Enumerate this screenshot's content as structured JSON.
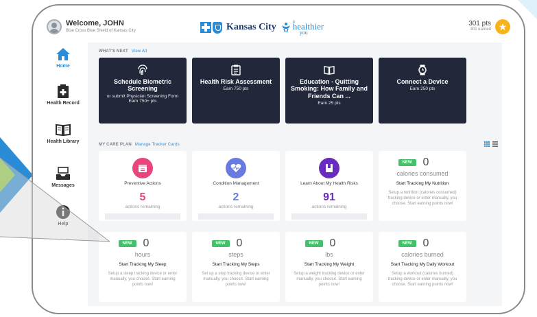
{
  "header": {
    "welcome": "Welcome, JOHN",
    "subtitle": "Blue Cross Blue Shield of Kansas City",
    "brand_city": "Kansas City",
    "brand_a": "a",
    "brand_healthier": "healthier",
    "brand_you": "you",
    "points": "301 pts",
    "points_earned": "301 earned"
  },
  "sidebar": {
    "items": [
      {
        "label": "Home",
        "icon": "home-icon",
        "active": true
      },
      {
        "label": "Health Record",
        "icon": "medical-record-icon"
      },
      {
        "label": "Health Library",
        "icon": "book-icon"
      },
      {
        "label": "Messages",
        "icon": "inbox-icon"
      },
      {
        "label": "Help",
        "icon": "info-icon"
      }
    ]
  },
  "whats_next": {
    "title": "WHAT'S NEXT",
    "link": "View All",
    "cards": [
      {
        "title": "Schedule Biometric Screening",
        "sub": "or submit Physician Screening Form",
        "pts": "Earn 750+ pts",
        "icon": "fingerprint-icon"
      },
      {
        "title": "Health Risk Assessment",
        "pts": "Earn 750 pts",
        "icon": "clipboard-icon"
      },
      {
        "title": "Education - Quitting Smoking: How Family and Friends Can ...",
        "pts": "Earn 25 pts",
        "icon": "open-book-icon"
      },
      {
        "title": "Connect a Device",
        "pts": "Earn 250 pts",
        "icon": "watch-icon"
      }
    ]
  },
  "care_plan": {
    "title": "MY CARE PLAN",
    "link": "Manage Tracker Cards",
    "cards": [
      {
        "name": "Preventive Actions",
        "value": "5",
        "sub": "actions remaining",
        "color": "#e8457e"
      },
      {
        "name": "Condition Management",
        "value": "2",
        "sub": "actions remaining",
        "color": "#6a7be0"
      },
      {
        "name": "Learn About My Health Risks",
        "value": "91",
        "sub": "actions remaining",
        "color": "#6a2bbf"
      }
    ],
    "trackers": [
      {
        "badge": "NEW",
        "value": "0",
        "unit": "calories consumed",
        "title": "Start Tracking My Nutrition",
        "desc": "Setup a nutrition (calories consumed) tracking device or enter manually, you choose. Start earning points now!"
      },
      {
        "badge": "NEW",
        "value": "0",
        "unit": "hours",
        "title": "Start Tracking My Sleep",
        "desc": "Setup a sleep tracking device or enter manually, you choose. Start earning points now!"
      },
      {
        "badge": "NEW",
        "value": "0",
        "unit": "steps",
        "title": "Start Tracking My Steps",
        "desc": "Set up a step tracking device or enter manually, you choose. Start earning points now!"
      },
      {
        "badge": "NEW",
        "value": "0",
        "unit": "lbs",
        "title": "Start Tracking My Weight",
        "desc": "Setup a weight tracking device or enter manually, you choose. Start earning points now!"
      },
      {
        "badge": "NEW",
        "value": "0",
        "unit": "calories burned",
        "title": "Start Tracking My Daily Workout",
        "desc": "Setup a workout (calories burned) tracking device or enter manually, you choose. Start earning points now!"
      }
    ]
  },
  "colors": {
    "accent": "#2a8bd6",
    "dark_card": "#22283a",
    "new_badge": "#43c26b",
    "star": "#f7b31b"
  }
}
